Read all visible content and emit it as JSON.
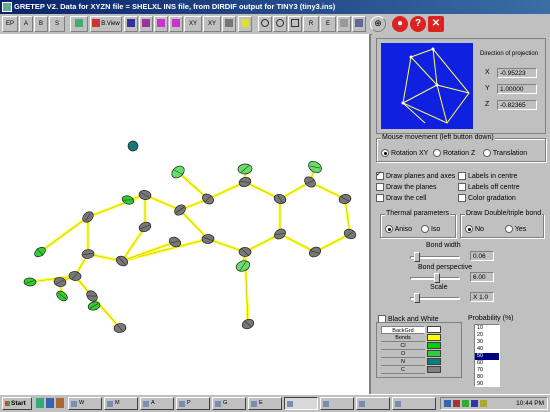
{
  "window": {
    "title": "GRETEP V2. Data for XYZN file = SHELXL INS file, from DIRDIF output for TINY3 (tiny3.ins)"
  },
  "toolbar": {
    "buttons": [
      {
        "name": "ortep-button",
        "label": "EP"
      },
      {
        "name": "tool-a-button",
        "label": "A"
      },
      {
        "name": "tool-b-button",
        "label": "B"
      },
      {
        "name": "tool-s-button",
        "label": "S"
      },
      {
        "name": "bview-button",
        "label": "B.View"
      },
      {
        "name": "rotate-xy-button",
        "label": "XY"
      },
      {
        "name": "pan-button",
        "label": "XY"
      },
      {
        "name": "reduce-button",
        "label": "R"
      },
      {
        "name": "enlarge-button",
        "label": "E"
      }
    ],
    "help_label": "?",
    "close_label": "✕",
    "stop_label": "●"
  },
  "projection": {
    "title": "Direction of projection",
    "x_label": "X",
    "x_value": "-0.95223",
    "y_label": "Y",
    "y_value": "1.00000",
    "z_label": "Z",
    "z_value": "-0.82365"
  },
  "mouse_movement": {
    "title": "Mouse movement (left button down)",
    "options": [
      {
        "label": "Rotation XY",
        "selected": true
      },
      {
        "label": "Rotation Z",
        "selected": false
      },
      {
        "label": "Translation",
        "selected": false
      }
    ]
  },
  "display_options": {
    "left": [
      {
        "label": "Draw planes and axes",
        "checked": true
      },
      {
        "label": "Draw the planes",
        "checked": false
      },
      {
        "label": "Draw the cell",
        "checked": false
      }
    ],
    "right": [
      {
        "label": "Labels in centre",
        "checked": false
      },
      {
        "label": "Labels off centre",
        "checked": false
      },
      {
        "label": "Color gradation",
        "checked": false
      }
    ]
  },
  "thermal": {
    "title": "Thermal parameters",
    "options": [
      {
        "label": "Aniso",
        "selected": true
      },
      {
        "label": "Iso",
        "selected": false
      }
    ]
  },
  "double_bond": {
    "title": "Draw Double/triple bond",
    "options": [
      {
        "label": "No",
        "selected": true
      },
      {
        "label": "Yes",
        "selected": false
      }
    ]
  },
  "sliders": {
    "bond_width": {
      "label": "Bond width",
      "value": "0.06",
      "level": 0.08
    },
    "bond_perspective": {
      "label": "Bond perspective",
      "value": "6.00",
      "level": 0.55
    },
    "scale": {
      "label": "Scale",
      "value": "X 1.0",
      "level": 0.08
    }
  },
  "black_white": {
    "label": "Black and White",
    "checked": false
  },
  "colors": {
    "rows": [
      {
        "label": "BackGrd",
        "color": "#ffffff"
      },
      {
        "label": "Bonds",
        "color": "#ffff00"
      },
      {
        "label": "Cl",
        "color": "#00cc00"
      },
      {
        "label": "O",
        "color": "#2ecc40"
      },
      {
        "label": "N",
        "color": "#008080"
      },
      {
        "label": "C",
        "color": "#808080"
      }
    ]
  },
  "probability": {
    "title": "Probability (%)",
    "options": [
      "10",
      "20",
      "30",
      "40",
      "50",
      "60",
      "70",
      "80",
      "90"
    ],
    "selected": "50"
  },
  "taskbar": {
    "start_label": "Start",
    "tasks": [
      "W",
      "M",
      "A",
      "P",
      "G",
      "E"
    ],
    "clock": "10:44 PM"
  },
  "molecule": {
    "colors": {
      "carbon": "#777777",
      "chlorine": "#33cc33",
      "oxygen": "#66dd66",
      "nitrogen": "#117777",
      "bond": "#ffff33"
    }
  }
}
